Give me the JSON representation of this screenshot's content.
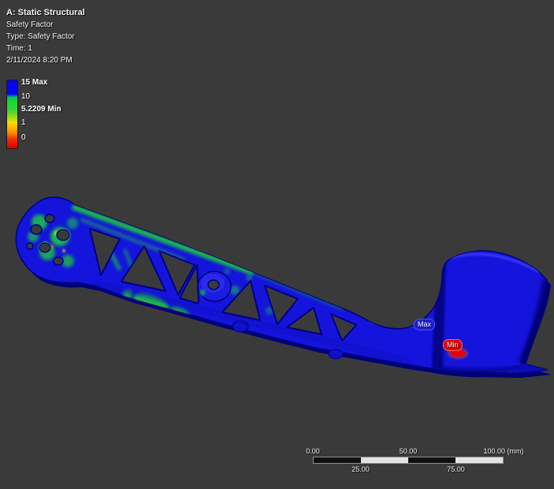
{
  "header": {
    "title": "A: Static Structural",
    "result_name": "Safety Factor",
    "type_line": "Type: Safety Factor",
    "time_line": "Time: 1",
    "datetime": "2/11/2024 8:20 PM"
  },
  "legend": {
    "entries": [
      {
        "label": "15 Max",
        "bold": true
      },
      {
        "label": "10",
        "bold": false
      },
      {
        "label": "5.2209 Min",
        "bold": true
      },
      {
        "label": "1",
        "bold": false
      },
      {
        "label": "0",
        "bold": false
      }
    ],
    "band_colors": [
      "#0404f0",
      "#16d62c",
      "#f2e000",
      "#ffb400",
      "#ff8200",
      "#e00000"
    ]
  },
  "model": {
    "max_label": "Max",
    "min_label": "Min",
    "body_color": "#1414dc",
    "shadow_color": "#000075",
    "accent_color": "#1ec83c",
    "min_spot_color": "#e60000"
  },
  "scale_bar": {
    "unit": "(mm)",
    "top_labels": [
      "0.00",
      "50.00",
      "100.00 (mm)"
    ],
    "bottom_labels": [
      "25.00",
      "75.00"
    ]
  }
}
